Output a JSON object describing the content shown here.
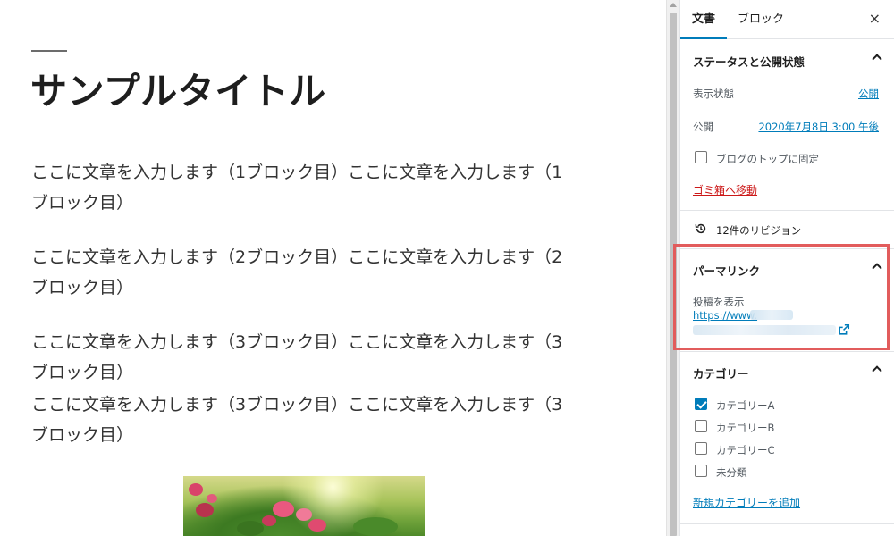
{
  "editor": {
    "title": "サンプルタイトル",
    "paragraphs": [
      "ここに文章を入力します（1ブロック目）ここに文章を入力します（1ブロック目）",
      "ここに文章を入力します（2ブロック目）ここに文章を入力します（2ブロック目）",
      "ここに文章を入力します（3ブロック目）ここに文章を入力します（3ブロック目）",
      "ここに文章を入力します（3ブロック目）ここに文章を入力します（3ブロック目）"
    ]
  },
  "sidebar": {
    "tabs": {
      "document": "文書",
      "block": "ブロック"
    },
    "close_symbol": "×",
    "status_panel": {
      "title": "ステータスと公開状態",
      "visibility_label": "表示状態",
      "visibility_value": "公開",
      "publish_label": "公開",
      "publish_value": "2020年7月8日 3:00 午後",
      "sticky_label": "ブログのトップに固定",
      "sticky_checked": false,
      "trash_label": "ゴミ箱へ移動"
    },
    "revisions": {
      "label": "12件のリビジョン"
    },
    "permalink_panel": {
      "title": "パーマリンク",
      "view_label": "投稿を表示",
      "url_prefix": "https://www."
    },
    "category_panel": {
      "title": "カテゴリー",
      "items": [
        {
          "label": "カテゴリーA",
          "checked": true
        },
        {
          "label": "カテゴリーB",
          "checked": false
        },
        {
          "label": "カテゴリーC",
          "checked": false
        },
        {
          "label": "未分類",
          "checked": false
        }
      ],
      "add_new": "新規カテゴリーを追加"
    }
  },
  "colors": {
    "accent": "#007cba",
    "highlight": "#e25c5c",
    "danger": "#cc1818"
  }
}
